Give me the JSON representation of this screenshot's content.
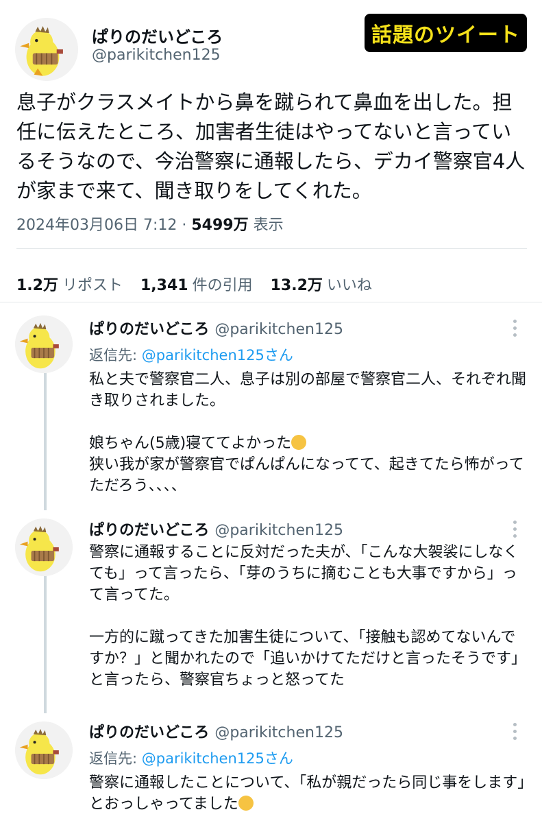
{
  "badge": "話題のツイート",
  "main": {
    "name": "ぱりのだいどころ",
    "handle": "@parikitchen125",
    "text": "息子がクラスメイトから鼻を蹴られて鼻血を出した。担任に伝えたところ、加害者生徒はやってないと言っているそうなので、今治警察に通報したら、デカイ警察官4人が家まで来て、聞き取りをしてくれた。",
    "date": "2024年03月06日 7:12 · ",
    "views_count": "5499万",
    "views_label": " 表示",
    "stats": {
      "reposts_count": "1.2万",
      "reposts_label": "リポスト",
      "quotes_count": "1,341",
      "quotes_label": "件の引用",
      "likes_count": "13.2万",
      "likes_label": "いいね"
    }
  },
  "replies": [
    {
      "name": "ぱりのだいどころ",
      "handle": "@parikitchen125",
      "reply_to_prefix": "返信先: ",
      "reply_to_handle": "@parikitchen125さん",
      "p1": "私と夫で警察官二人、息子は別の部屋で警察官二人、それぞれ聞き取りされました。",
      "p2a": "娘ちゃん(5歳)寝ててよかった",
      "p2b": "狭い我が家が警察官でぱんぱんになってて、起きてたら怖がってただろう、、、、"
    },
    {
      "name": "ぱりのだいどころ",
      "handle": "@parikitchen125",
      "p1": "警察に通報することに反対だった夫が、「こんな大袈裟にしなくても」って言ったら、「芽のうちに摘むことも大事ですから」って言ってた。",
      "p2": "一方的に蹴ってきた加害生徒について、「接触も認めてないんですか？」と聞かれたので「追いかけてただけと言ったそうです」と言ったら、警察官ちょっと怒ってた"
    },
    {
      "name": "ぱりのだいどころ",
      "handle": "@parikitchen125",
      "reply_to_prefix": "返信先: ",
      "reply_to_handle": "@parikitchen125さん",
      "p1": "警察に通報したことについて、「私が親だったら同じ事をします」とおっしゃってました"
    }
  ]
}
